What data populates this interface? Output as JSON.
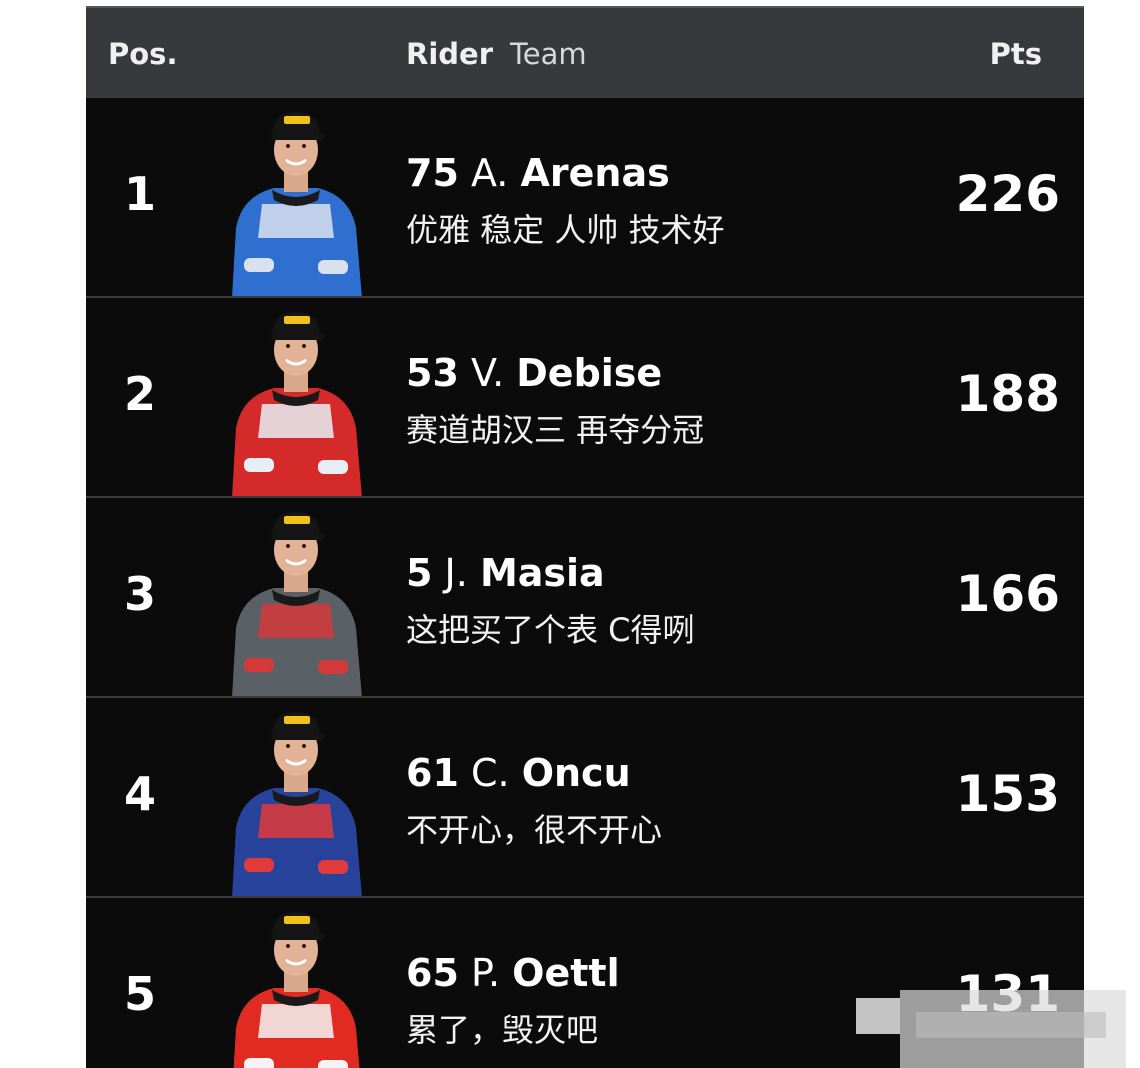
{
  "header": {
    "pos_label": "Pos.",
    "rider_label": "Rider",
    "team_label": "Team",
    "pts_label": "Pts"
  },
  "riders": [
    {
      "pos": "1",
      "number": "75",
      "initial": "A.",
      "surname": "Arenas",
      "team": "优雅 稳定 人帅 技术好",
      "pts": "226",
      "suit_color": "#2f6fd0",
      "suit_accent": "#d9e1ee"
    },
    {
      "pos": "2",
      "number": "53",
      "initial": "V.",
      "surname": "Debise",
      "team": "赛道胡汉三 再夺分冠",
      "pts": "188",
      "suit_color": "#d42a2a",
      "suit_accent": "#e8eef5"
    },
    {
      "pos": "3",
      "number": "5",
      "initial": "J.",
      "surname": "Masia",
      "team": "这把买了个表 C得咧",
      "pts": "166",
      "suit_color": "#5b5f66",
      "suit_accent": "#d33a3a"
    },
    {
      "pos": "4",
      "number": "61",
      "initial": "C.",
      "surname": "Oncu",
      "team": "不开心，很不开心",
      "pts": "153",
      "suit_color": "#28439c",
      "suit_accent": "#e03a3a"
    },
    {
      "pos": "5",
      "number": "65",
      "initial": "P.",
      "surname": "Oettl",
      "team": "累了，毁灭吧",
      "pts": "131",
      "suit_color": "#e02a22",
      "suit_accent": "#f4f4f4"
    }
  ],
  "colors": {
    "background": "#0d0d0d",
    "header_bg": "#38393c",
    "text": "#ffffff"
  },
  "icons": {
    "rider_photo": "rider-portrait-icon",
    "watermark": "watermark-overlay"
  }
}
